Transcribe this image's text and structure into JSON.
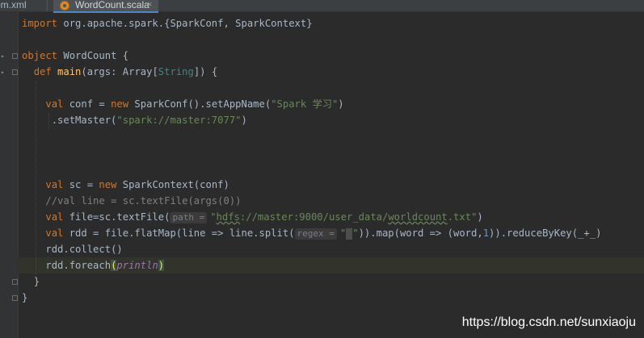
{
  "tabs": [
    {
      "label": "om.xml"
    },
    {
      "label": "WordCount.scala",
      "close": "×"
    }
  ],
  "code": {
    "import_kw": "import",
    "import_rest": " org.apache.spark.{SparkConf, SparkContext}",
    "object_kw": "object",
    "object_rest": " WordCount {",
    "def_kw": "def",
    "main_name": "main",
    "main_args_a": "(args: Array[",
    "main_args_type": "String",
    "main_args_b": "]) {",
    "val1": "val",
    "conf_a": " conf = ",
    "new1": "new",
    "conf_b": " SparkConf().setAppName(",
    "appname": "\"Spark 学习\"",
    "conf_c": ")",
    "setmaster_a": ".setMaster(",
    "master_url": "\"spark://master:7077\"",
    "setmaster_b": ")",
    "val2": "val",
    "sc_a": " sc = ",
    "new2": "new",
    "sc_b": " SparkContext(conf)",
    "comment": "//val line = sc.textFile(args(0))",
    "val3": "val",
    "file_a": " file=sc.textFile(",
    "path_hint": "path =",
    "file_str_a": "\"",
    "file_str_b": "hdfs",
    "file_str_c": "://master:9000/user_data/",
    "file_str_d": "worldcount",
    "file_str_e": ".txt\"",
    "file_b": ")",
    "val4": "val",
    "rdd_a": " rdd = file.flatMap(line => line.split(",
    "regex_hint": "regex =",
    "rdd_str_a": "\"",
    "rdd_str_b": "\"",
    "rdd_b": ")).map(word => (word,",
    "rdd_num": "1",
    "rdd_c": ")).reduceByKey(_+_)",
    "collect": "rdd.collect()",
    "foreach_a": "rdd.foreach",
    "foreach_open": "(",
    "foreach_fn": "println",
    "foreach_close": ")",
    "close_inner": "}",
    "close_outer": "}"
  },
  "watermark": "https://blog.csdn.net/sunxiaoju",
  "colors": {
    "background": "#2b2b2b",
    "keyword": "#cc7832",
    "string": "#6a8759",
    "number": "#6897bb",
    "comment": "#808080"
  }
}
